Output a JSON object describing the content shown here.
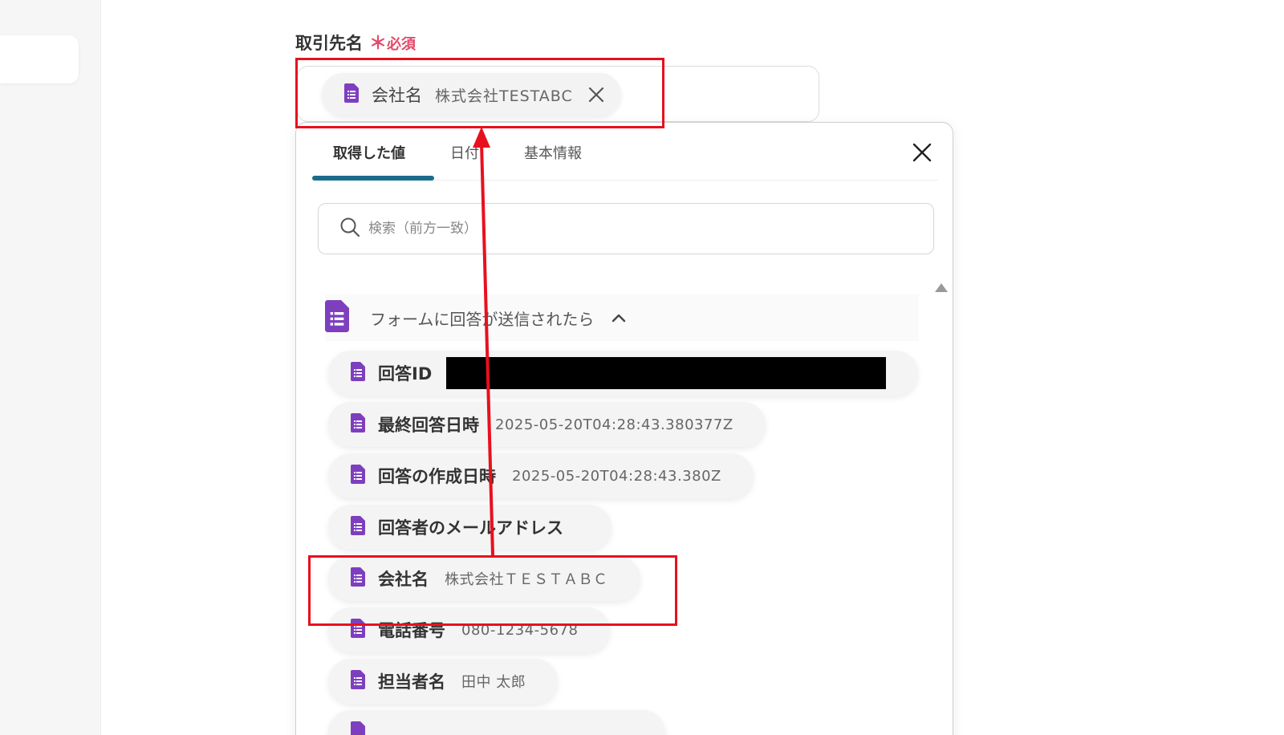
{
  "field": {
    "label": "取引先名",
    "required_mark": "＊",
    "required_text": "必須",
    "selected_chip": {
      "label": "会社名",
      "value": "株式会社TESTABC"
    }
  },
  "popup": {
    "tabs": [
      {
        "label": "取得した値",
        "active": true
      },
      {
        "label": "日付",
        "active": false
      },
      {
        "label": "基本情報",
        "active": false
      }
    ],
    "search": {
      "placeholder": "検索（前方一致）"
    },
    "section": {
      "title": "フォームに回答が送信されたら"
    },
    "items": [
      {
        "label": "回答ID",
        "value": ""
      },
      {
        "label": "最終回答日時",
        "value": "2025-05-20T04:28:43.380377Z"
      },
      {
        "label": "回答の作成日時",
        "value": "2025-05-20T04:28:43.380Z"
      },
      {
        "label": "回答者のメールアドレス",
        "value": ""
      },
      {
        "label": "会社名",
        "value": "株式会社ＴＥＳＴＡＢＣ"
      },
      {
        "label": "電話番号",
        "value": "080-1234-5678"
      },
      {
        "label": "担当者名",
        "value": "田中 太郎"
      }
    ]
  },
  "colors": {
    "accent_tab": "#1b6c8a",
    "forms_purple": "#7e3fbf",
    "highlight_red": "#e8101e",
    "required_pink": "#e24a6a"
  },
  "icons": {
    "field_item": "google-forms-icon",
    "close": "close-icon",
    "search": "search-icon",
    "collapse": "chevron-up-icon"
  }
}
